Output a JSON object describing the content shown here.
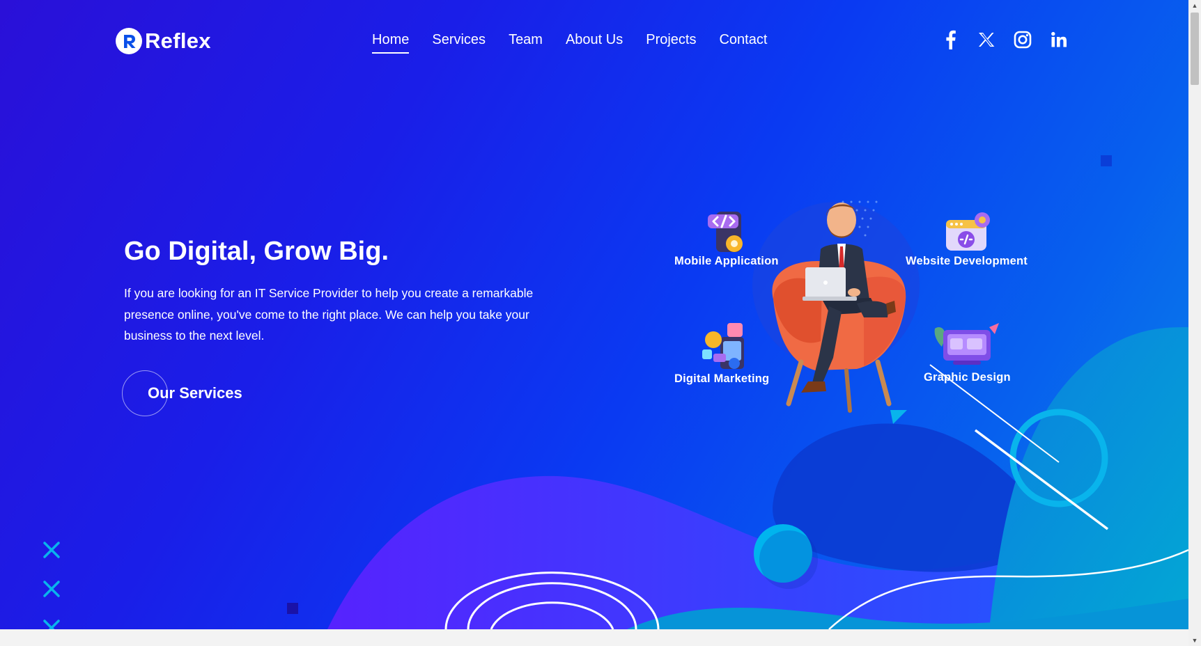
{
  "brand": {
    "name": "Reflex"
  },
  "nav": {
    "items": [
      {
        "label": "Home",
        "active": true
      },
      {
        "label": "Services"
      },
      {
        "label": "Team"
      },
      {
        "label": "About Us"
      },
      {
        "label": "Projects"
      },
      {
        "label": "Contact"
      }
    ]
  },
  "social": {
    "icons": [
      "facebook-icon",
      "x-icon",
      "instagram-icon",
      "linkedin-icon"
    ]
  },
  "hero": {
    "title": "Go Digital, Grow Big.",
    "description": "If you are looking for an IT Service Provider to help you create a remarkable presence online, you've come to the right place. We can help you take your business to the next level.",
    "cta_label": "Our Services"
  },
  "services": {
    "mobile": "Mobile Application",
    "website": "Website Development",
    "marketing": "Digital Marketing",
    "graphic": "Graphic Design"
  },
  "colors": {
    "accent": "#00b4ee",
    "gradient_start": "#2a10d8",
    "gradient_end": "#0a86e8"
  }
}
